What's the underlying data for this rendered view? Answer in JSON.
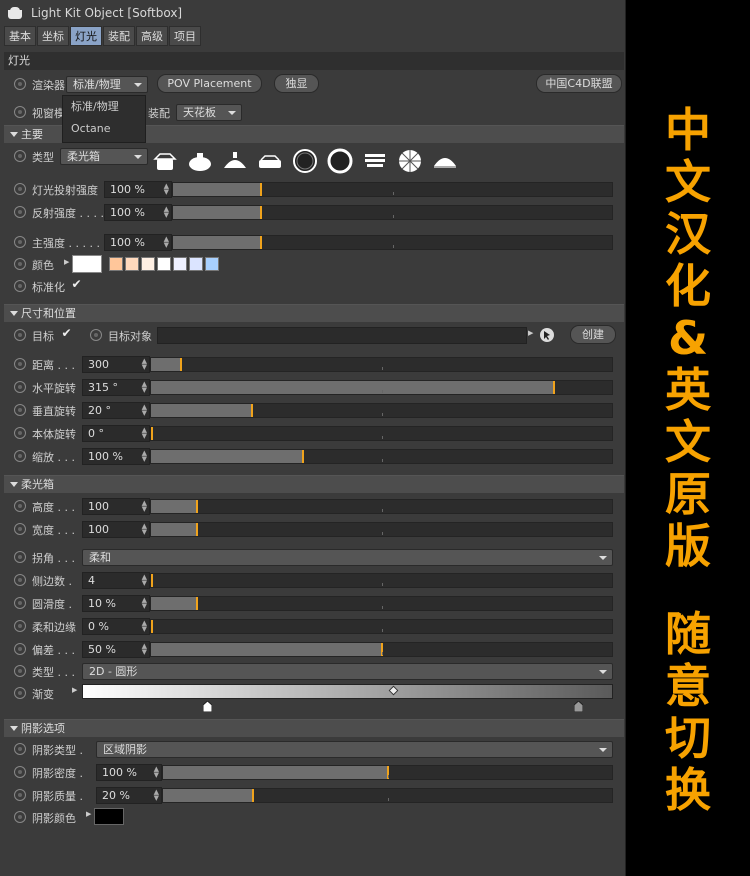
{
  "window": {
    "title": "Light Kit Object [Softbox]"
  },
  "tabs": [
    "基本",
    "坐标",
    "灯光",
    "装配",
    "高级",
    "项目"
  ],
  "active_tab": "灯光",
  "light_section": "灯光",
  "renderer": {
    "label": "渲染器",
    "value": "标准/物理",
    "options": [
      "标准/物理",
      "Octane"
    ],
    "pov_button": "POV Placement",
    "solo_button": "独显",
    "brand_button": "中国C4D联盟"
  },
  "viewport": {
    "label": "视窗模式",
    "rig_label": "装配",
    "rig_value": "天花板"
  },
  "main": {
    "header": "主要",
    "type_label": "类型",
    "type_value": "柔光箱",
    "shape_icons": [
      "softbox-icon",
      "dome-icon",
      "dome-narrow-icon",
      "softbox-flat-icon",
      "ring-icon",
      "ring-large-icon",
      "striped-icon",
      "octa-icon",
      "halfdome-icon"
    ],
    "cast_label": "灯光投射强度",
    "cast_value": "100 %",
    "cast_level": 0.2,
    "reflect_label": "反射强度 . . . .",
    "reflect_value": "100 %",
    "reflect_level": 0.2,
    "master_label": "主强度 . . . . .",
    "master_value": "100 %",
    "master_level": 0.2,
    "color_label": "颜色",
    "swatches": [
      "#ffffff",
      "#ffc69a",
      "#ffd9bd",
      "#fff0e4",
      "#ffffff",
      "#eef0ff",
      "#dbe4ff",
      "#a8d0ff"
    ],
    "normalize_label": "标准化"
  },
  "size": {
    "header": "尺寸和位置",
    "target_label": "目标",
    "target_obj_label": "目标对象",
    "create_button": "创建",
    "rows": [
      {
        "label": "距离 . . .",
        "value": "300",
        "level": 0.065
      },
      {
        "label": "水平旋转",
        "value": "315 °",
        "level": 0.875
      },
      {
        "label": "垂直旋转",
        "value": "20 °",
        "level": 0.22
      },
      {
        "label": "本体旋转",
        "value": "0 °",
        "level": 0.0
      },
      {
        "label": "缩放 . . .",
        "value": "100 %",
        "level": 0.33
      }
    ]
  },
  "softbox": {
    "header": "柔光箱",
    "height_label": "高度 . . .",
    "height_value": "100",
    "height_level": 0.1,
    "width_label": "宽度 . . .",
    "width_value": "100",
    "width_level": 0.1,
    "corner_label": "拐角 . . .",
    "corner_value": "柔和",
    "sides_label": "侧边数 .",
    "sides_value": "4",
    "sides_level": 0.0,
    "round_label": "圆滑度 .",
    "round_value": "10 %",
    "round_level": 0.1,
    "soft_label": "柔和边缘",
    "soft_value": "0 %",
    "soft_level": 0.0,
    "bias_label": "偏差 . . .",
    "bias_value": "50 %",
    "bias_level": 0.5,
    "type_label": "类型 . . .",
    "type_value": "2D - 圆形",
    "gradient_label": "渐变"
  },
  "shadow": {
    "header": "阴影选项",
    "type_label": "阴影类型 .",
    "type_value": "区域阴影",
    "density_label": "阴影密度 .",
    "density_value": "100 %",
    "density_level": 0.5,
    "quality_label": "阴影质量 .",
    "quality_value": "20 %",
    "quality_level": 0.2,
    "color_label": "阴影颜色"
  },
  "banner": {
    "line1": [
      "中",
      "文",
      "汉",
      "化",
      "&",
      "英",
      "文",
      "原",
      "版"
    ],
    "line2": [
      "随",
      "意",
      "切",
      "换"
    ]
  },
  "colors": {
    "accent": "#f0a31c",
    "banner": "#f7a200",
    "active_tab": "#8aa3c7"
  }
}
